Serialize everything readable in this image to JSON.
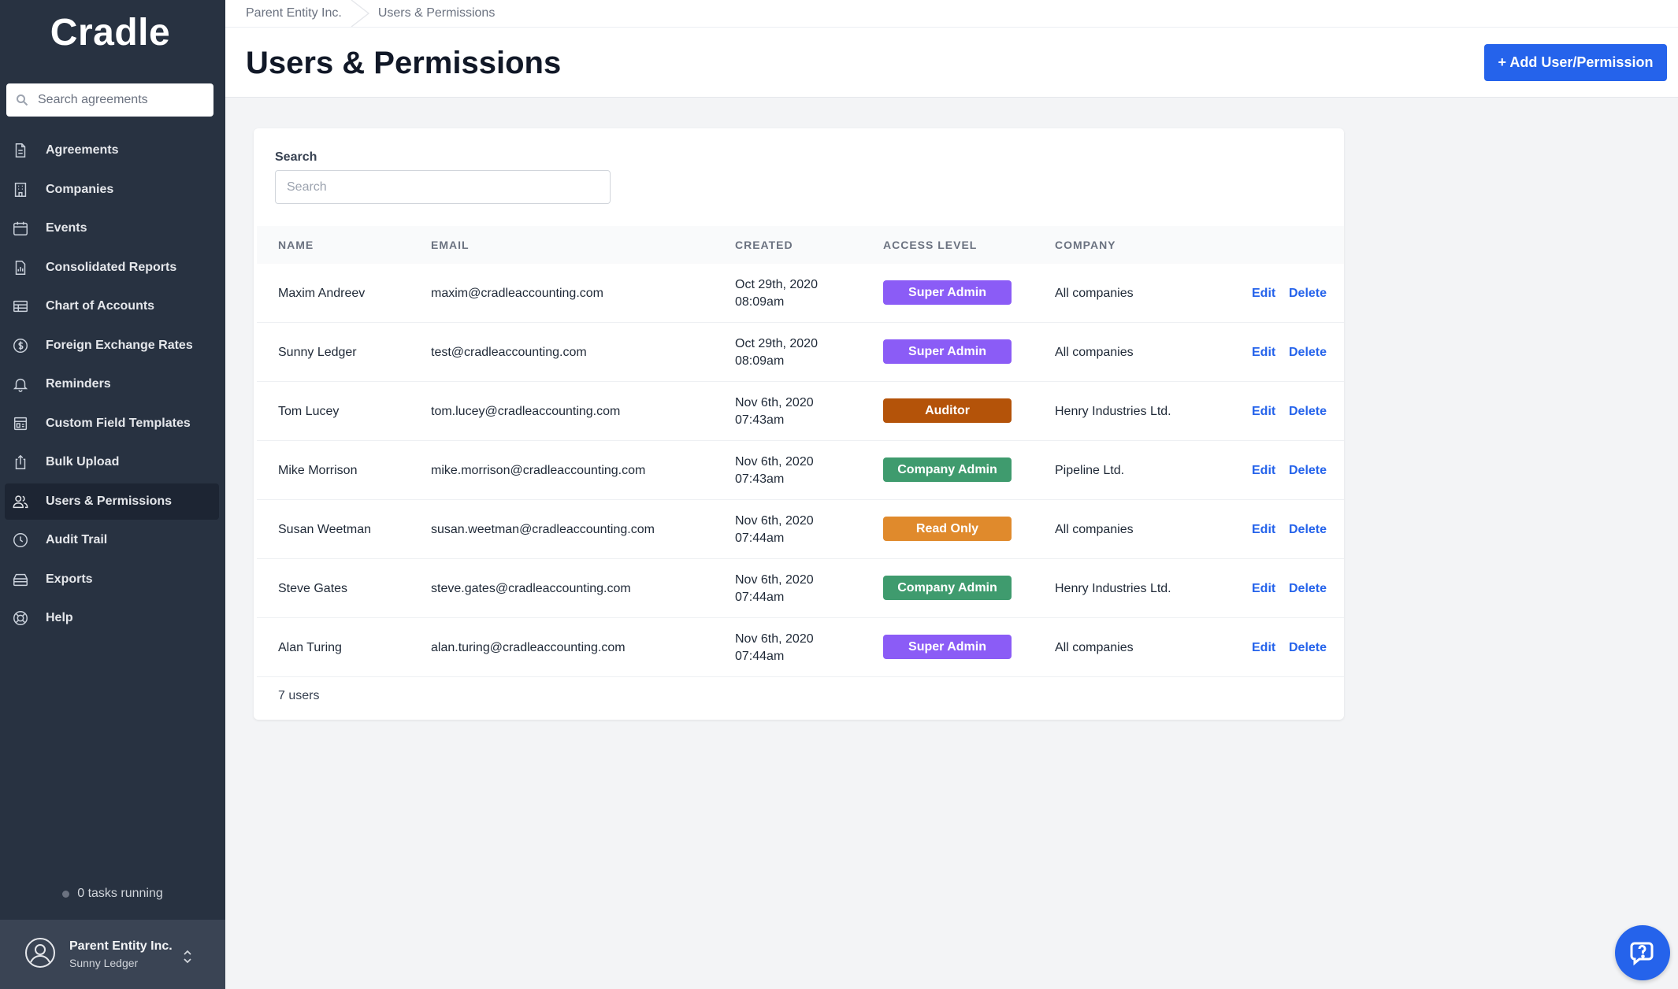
{
  "app": {
    "logo": "Cradle"
  },
  "sidebar": {
    "search_placeholder": "Search agreements",
    "items": [
      {
        "label": "Agreements",
        "icon": "document-icon"
      },
      {
        "label": "Companies",
        "icon": "building-icon"
      },
      {
        "label": "Events",
        "icon": "calendar-icon"
      },
      {
        "label": "Consolidated Reports",
        "icon": "report-icon"
      },
      {
        "label": "Chart of Accounts",
        "icon": "table-icon"
      },
      {
        "label": "Foreign Exchange Rates",
        "icon": "currency-icon"
      },
      {
        "label": "Reminders",
        "icon": "bell-icon"
      },
      {
        "label": "Custom Field Templates",
        "icon": "template-icon"
      },
      {
        "label": "Bulk Upload",
        "icon": "upload-icon"
      },
      {
        "label": "Users & Permissions",
        "icon": "users-icon",
        "active": true
      },
      {
        "label": "Audit Trail",
        "icon": "clock-icon"
      },
      {
        "label": "Exports",
        "icon": "archive-icon"
      },
      {
        "label": "Help",
        "icon": "lifebuoy-icon"
      }
    ],
    "tasks_status": "0 tasks running",
    "account": {
      "entity": "Parent Entity Inc.",
      "user": "Sunny Ledger"
    }
  },
  "header": {
    "breadcrumb": [
      "Parent Entity Inc.",
      "Users & Permissions"
    ],
    "title": "Users & Permissions",
    "add_button": "+ Add User/Permission"
  },
  "filter": {
    "label": "Search",
    "placeholder": "Search",
    "value": ""
  },
  "table": {
    "columns": [
      "NAME",
      "EMAIL",
      "CREATED",
      "ACCESS LEVEL",
      "COMPANY"
    ],
    "actions": {
      "edit": "Edit",
      "delete": "Delete"
    },
    "rows": [
      {
        "name": "Maxim Andreev",
        "email": "maxim@cradleaccounting.com",
        "date": "Oct 29th, 2020",
        "time": "08:09am",
        "access": "Super Admin",
        "company": "All companies"
      },
      {
        "name": "Sunny Ledger",
        "email": "test@cradleaccounting.com",
        "date": "Oct 29th, 2020",
        "time": "08:09am",
        "access": "Super Admin",
        "company": "All companies"
      },
      {
        "name": "Tom Lucey",
        "email": "tom.lucey@cradleaccounting.com",
        "date": "Nov 6th, 2020",
        "time": "07:43am",
        "access": "Auditor",
        "company": "Henry Industries Ltd."
      },
      {
        "name": "Mike Morrison",
        "email": "mike.morrison@cradleaccounting.com",
        "date": "Nov 6th, 2020",
        "time": "07:43am",
        "access": "Company Admin",
        "company": "Pipeline Ltd."
      },
      {
        "name": "Susan Weetman",
        "email": "susan.weetman@cradleaccounting.com",
        "date": "Nov 6th, 2020",
        "time": "07:44am",
        "access": "Read Only",
        "company": "All companies"
      },
      {
        "name": "Steve Gates",
        "email": "steve.gates@cradleaccounting.com",
        "date": "Nov 6th, 2020",
        "time": "07:44am",
        "access": "Company Admin",
        "company": "Henry Industries Ltd."
      },
      {
        "name": "Alan Turing",
        "email": "alan.turing@cradleaccounting.com",
        "date": "Nov 6th, 2020",
        "time": "07:44am",
        "access": "Super Admin",
        "company": "All companies"
      }
    ],
    "footer": "7 users"
  },
  "access_colors": {
    "Super Admin": "#8b5cf6",
    "Auditor": "#b45309",
    "Company Admin": "#3f9b6e",
    "Read Only": "#e08a2c"
  },
  "theme": {
    "sidebar_bg": "#283241",
    "accent": "#2563eb"
  },
  "help_button_icon": "chat-help-icon"
}
